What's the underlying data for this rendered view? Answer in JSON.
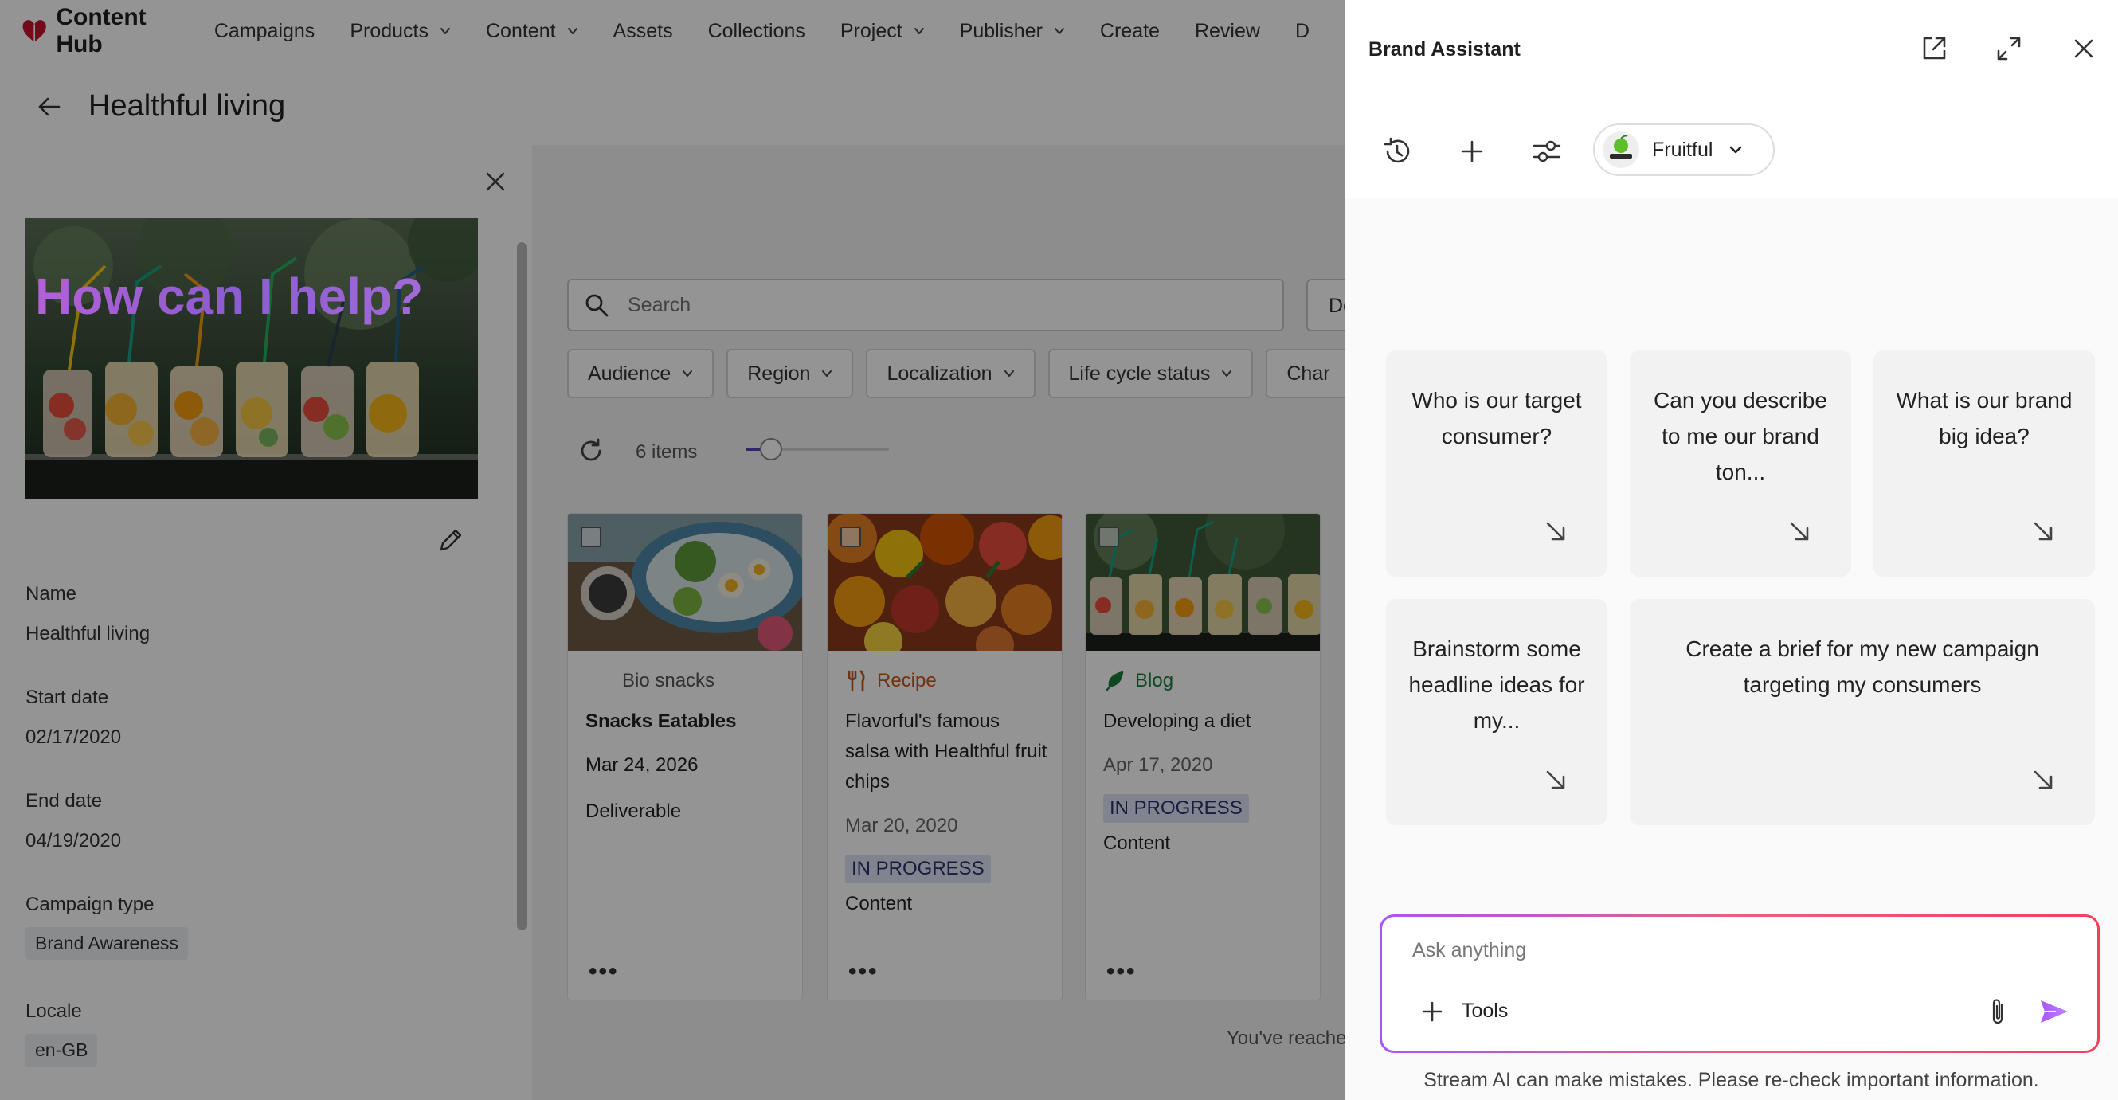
{
  "app": {
    "name": "Content Hub",
    "brand_color": "#c8102e"
  },
  "nav": {
    "items": [
      {
        "label": "Campaigns",
        "dropdown": false
      },
      {
        "label": "Products",
        "dropdown": true
      },
      {
        "label": "Content",
        "dropdown": true
      },
      {
        "label": "Assets",
        "dropdown": false
      },
      {
        "label": "Collections",
        "dropdown": false
      },
      {
        "label": "Project",
        "dropdown": true
      },
      {
        "label": "Publisher",
        "dropdown": true
      },
      {
        "label": "Create",
        "dropdown": false
      },
      {
        "label": "Review",
        "dropdown": false
      },
      {
        "label": "D",
        "dropdown": false
      }
    ]
  },
  "page": {
    "title": "Healthful living"
  },
  "details": {
    "name_label": "Name",
    "name_value": "Healthful living",
    "start_label": "Start date",
    "start_value": "02/17/2020",
    "end_label": "End date",
    "end_value": "04/19/2020",
    "type_label": "Campaign type",
    "type_value": "Brand Awareness",
    "locale_label": "Locale",
    "locale_value": "en-GB"
  },
  "search": {
    "placeholder": "Search",
    "extra_button": "De"
  },
  "filters": [
    "Audience",
    "Region",
    "Localization",
    "Life cycle status",
    "Char"
  ],
  "results": {
    "count": "6 items",
    "zoom_level": 0.18,
    "end_text": "You've reache"
  },
  "cards": [
    {
      "type": "Bio snacks",
      "type_icon": "none",
      "type_color": "#555555",
      "title": "Snacks Eatables",
      "date": "Mar 24, 2026",
      "status": "",
      "kind": "Deliverable"
    },
    {
      "type": "Recipe",
      "type_icon": "fork-knife-icon",
      "type_color": "#c5551a",
      "title": "Flavorful's famous salsa with Healthful fruit chips",
      "date": "Mar 20, 2020",
      "status": "IN PROGRESS",
      "kind": "Content"
    },
    {
      "type": "Blog",
      "type_icon": "feather-icon",
      "type_color": "#1a7a3a",
      "title": "Developing a diet",
      "date": "Apr 17, 2020",
      "status": "IN PROGRESS",
      "kind": "Content"
    }
  ],
  "assistant": {
    "title": "Brand Assistant",
    "persona": "Fruitful",
    "persona_logo_text": "Fruitful",
    "heading": "How can I help?",
    "suggestions": [
      "Who is our target consumer?",
      "Can you describe to me our brand ton...",
      "What is our brand big idea?",
      "Brainstorm some headline ideas for my...",
      "Create a brief for my new campaign targeting my consumers"
    ],
    "input_placeholder": "Ask anything",
    "tools_label": "Tools",
    "disclaimer": "Stream AI can make mistakes. Please re-check important information.",
    "accent": "#a855f7"
  }
}
